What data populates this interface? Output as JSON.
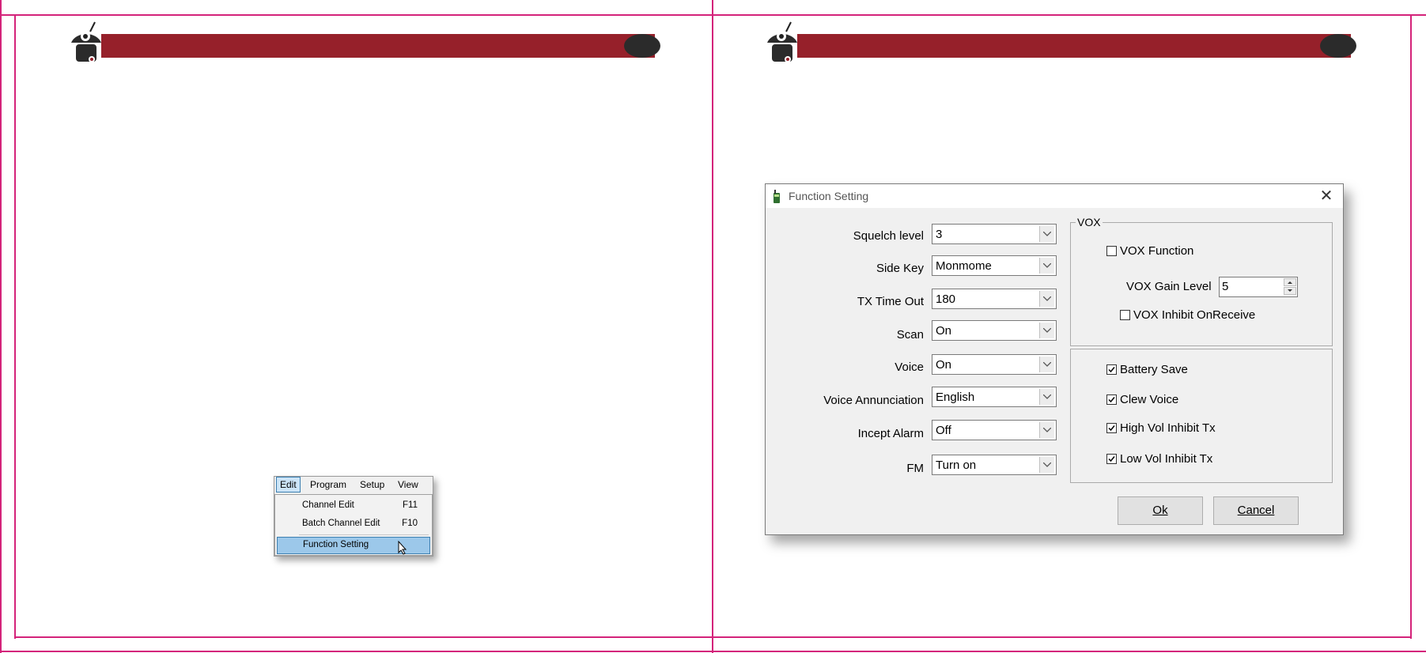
{
  "menu": {
    "bar": {
      "edit": "Edit",
      "program": "Program",
      "setup": "Setup",
      "view": "View"
    },
    "items": [
      {
        "label": "Channel Edit",
        "shortcut": "F11"
      },
      {
        "label": "Batch Channel Edit",
        "shortcut": "F10"
      },
      {
        "label": "Function Setting",
        "shortcut": ""
      }
    ]
  },
  "dialog": {
    "title": "Function Setting",
    "fields": [
      {
        "label": "Squelch level",
        "value": "3"
      },
      {
        "label": "Side Key",
        "value": "Monmome"
      },
      {
        "label": "TX Time Out",
        "value": "180"
      },
      {
        "label": "Scan",
        "value": "On"
      },
      {
        "label": "Voice",
        "value": "On"
      },
      {
        "label": "Voice Annunciation",
        "value": "English"
      },
      {
        "label": "Incept Alarm",
        "value": "Off"
      },
      {
        "label": "FM",
        "value": "Turn on"
      }
    ],
    "vox": {
      "legend": "VOX",
      "function_label": "VOX Function",
      "function_checked": false,
      "gain_label": "VOX Gain Level",
      "gain_value": "5",
      "inhibit_label": "VOX Inhibit OnReceive",
      "inhibit_checked": false
    },
    "options": [
      {
        "label": "Battery Save",
        "checked": true
      },
      {
        "label": "Clew Voice",
        "checked": true
      },
      {
        "label": "High Vol Inhibit Tx",
        "checked": true
      },
      {
        "label": "Low Vol Inhibit Tx",
        "checked": true
      }
    ],
    "ok_label": "Ok",
    "cancel_label": "Cancel"
  },
  "colors": {
    "header": "#96202a",
    "guide": "#d4237a",
    "selection": "#9cc8ea"
  }
}
